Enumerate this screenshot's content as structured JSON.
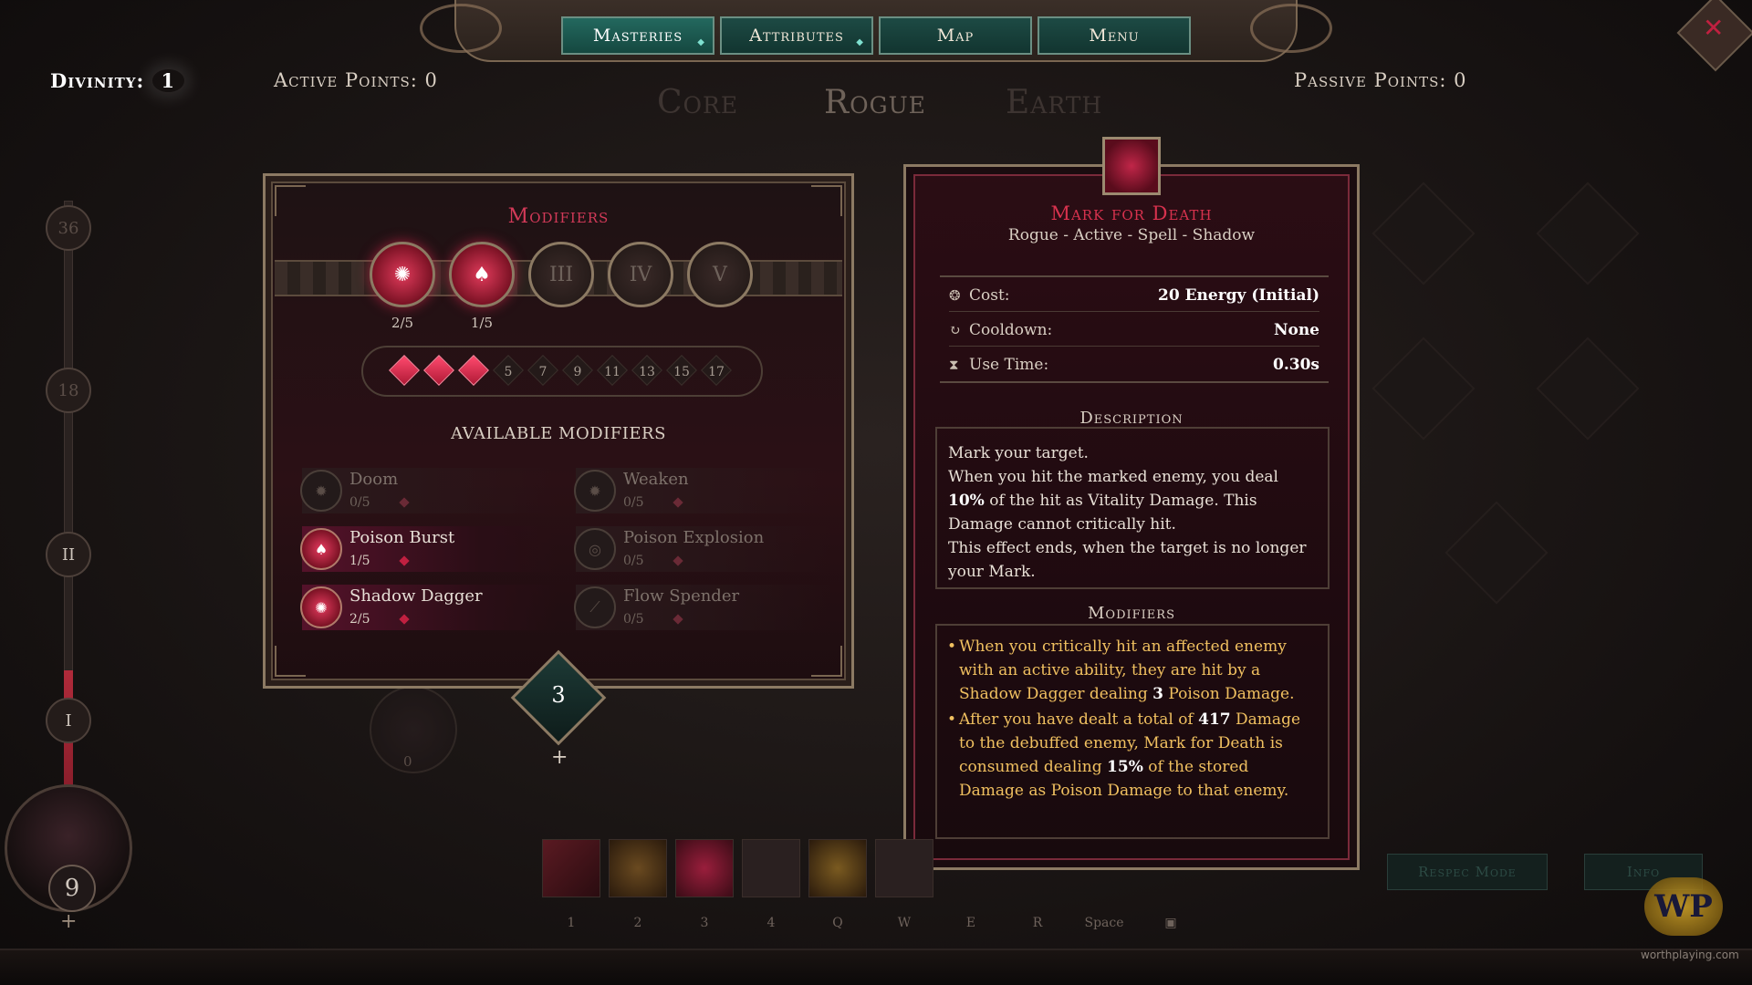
{
  "nav": {
    "tabs": [
      {
        "label": "Masteries",
        "has_dot": true
      },
      {
        "label": "Attributes",
        "has_dot": true
      },
      {
        "label": "Map",
        "has_dot": false
      },
      {
        "label": "Menu",
        "has_dot": false
      }
    ],
    "active_tab": "Masteries"
  },
  "header": {
    "divinity_label": "Divinity:",
    "divinity_value": "1",
    "active_points": "Active Points: 0",
    "passive_points": "Passive Points: 0",
    "trees": [
      "Core",
      "Rogue",
      "Earth"
    ],
    "active_tree": "Rogue"
  },
  "progress": {
    "nodes": [
      "36",
      "18",
      "II",
      "I"
    ],
    "level": "9",
    "plus": "+"
  },
  "modifiers_panel": {
    "title": "Modifiers",
    "slots": [
      {
        "label": "",
        "count": "2/5",
        "filled": true
      },
      {
        "label": "",
        "count": "1/5",
        "filled": true
      },
      {
        "label": "III",
        "count": "",
        "filled": false
      },
      {
        "label": "IV",
        "count": "",
        "filled": false
      },
      {
        "label": "V",
        "count": "",
        "filled": false
      }
    ],
    "pips": [
      {
        "label": "",
        "filled": true
      },
      {
        "label": "",
        "filled": true
      },
      {
        "label": "",
        "filled": true
      },
      {
        "label": "5",
        "filled": false
      },
      {
        "label": "7",
        "filled": false
      },
      {
        "label": "9",
        "filled": false
      },
      {
        "label": "11",
        "filled": false
      },
      {
        "label": "13",
        "filled": false
      },
      {
        "label": "15",
        "filled": false
      },
      {
        "label": "17",
        "filled": false
      }
    ],
    "available_title": "AVAILABLE MODIFIERS",
    "entries": [
      {
        "name": "Doom",
        "count": "0/5",
        "on": false
      },
      {
        "name": "Weaken",
        "count": "0/5",
        "on": false
      },
      {
        "name": "Poison Burst",
        "count": "1/5",
        "on": true
      },
      {
        "name": "Poison Explosion",
        "count": "0/5",
        "on": false
      },
      {
        "name": "Shadow Dagger",
        "count": "2/5",
        "on": true
      },
      {
        "name": "Flow Spender",
        "count": "0/5",
        "on": false
      }
    ],
    "cost_badge": "3",
    "cost_plus": "+",
    "ghost_node_value": "0"
  },
  "skill": {
    "name": "Mark for Death",
    "tags": "Rogue - Active - Spell - Shadow",
    "stats": [
      {
        "icon": "energy-icon",
        "glyph": "❂",
        "label": "Cost:",
        "value": "20 Energy (Initial)"
      },
      {
        "icon": "cooldown-icon",
        "glyph": "↻",
        "label": "Cooldown:",
        "value": "None"
      },
      {
        "icon": "hourglass-icon",
        "glyph": "⧗",
        "label": "Use Time:",
        "value": "0.30s"
      }
    ],
    "description_title": "Description",
    "description": {
      "line1": "Mark your target.",
      "line2a": "When you hit the marked enemy, you deal ",
      "line2b": "10%",
      "line2c": " of the hit as Vitality Damage. This Damage cannot critically hit.",
      "line3": "This effect ends, when the target is no longer your Mark."
    },
    "modifiers_title": "Modifiers",
    "modifiers": {
      "m1a": "When you critically hit an affected enemy with an active ability, they are hit by a Shadow Dagger dealing ",
      "m1b": "3",
      "m1c": " Poison Damage.",
      "m2a": "After you have dealt a total of ",
      "m2b": "417",
      "m2c": " Damage to the debuffed enemy, Mark for Death is consumed dealing ",
      "m2d": "15%",
      "m2e": " of the stored Damage as Poison Damage to that enemy."
    }
  },
  "hotbar": {
    "keys": [
      "1",
      "2",
      "3",
      "4",
      "Q",
      "W",
      "E",
      "R",
      "Space",
      ""
    ]
  },
  "footer": {
    "respec_button": "Respec Mode",
    "info_button": "Info",
    "watermark_logo": "WP",
    "watermark_url": "worthplaying.com"
  },
  "colors": {
    "accent_red": "#d8324e",
    "nav_teal": "#1d4a44",
    "gold_text": "#f0c060"
  }
}
